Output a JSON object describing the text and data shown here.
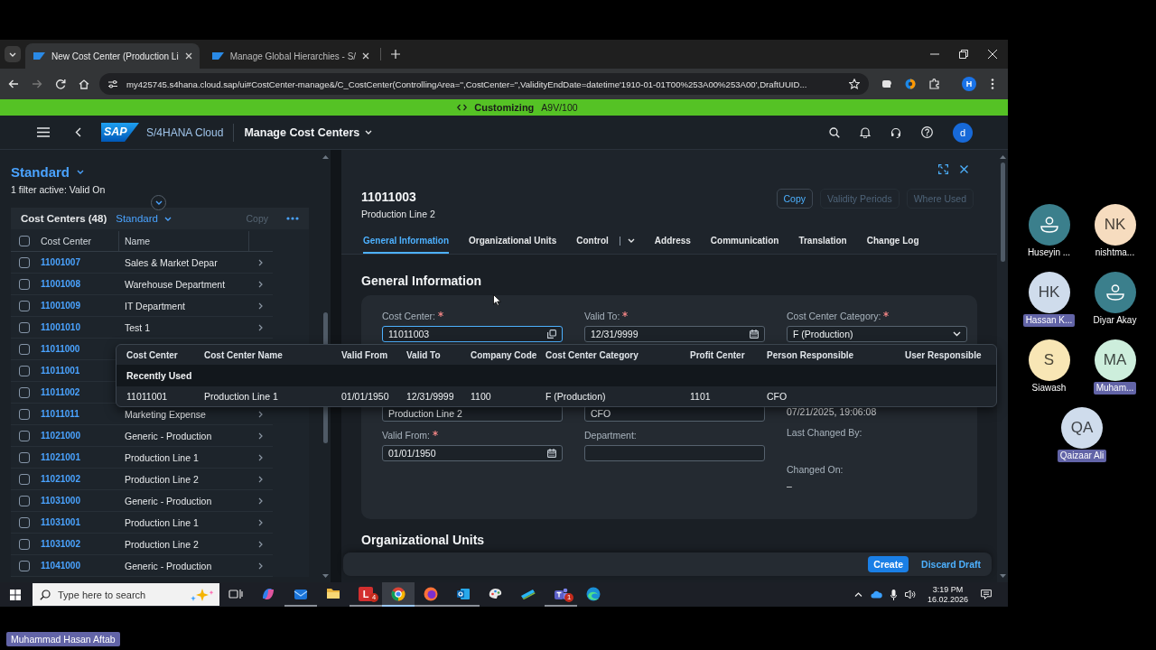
{
  "browser": {
    "tabs": [
      {
        "title": "New Cost Center (Production Li",
        "selected": true
      },
      {
        "title": "Manage Global Hierarchies - S/",
        "selected": false
      }
    ],
    "url": "my425745.s4hana.cloud.sap/ui#CostCenter-manage&/C_CostCenter(ControllingArea='',CostCenter='',ValidityEndDate=datetime'1910-01-01T00%253A00%253A00',DraftUUID...",
    "profile_initial": "H"
  },
  "system_bar": {
    "mode": "Customizing",
    "system": "A9V/100"
  },
  "shell_bar": {
    "logo": "SAP",
    "product": "S/4HANA Cloud",
    "app_title": "Manage Cost Centers",
    "user_initial": "d"
  },
  "list_pane": {
    "variant": "Standard",
    "filter_info": "1 filter active: Valid On",
    "table_title": "Cost Centers (48)",
    "table_variant": "Standard",
    "copy": {
      "label": "Copy",
      "disabled": true
    },
    "select_all_checked": false,
    "columns": [
      "Cost Center",
      "Name"
    ],
    "rows": [
      {
        "id": "11001007",
        "name": "Sales & Market Depar",
        "checked": false
      },
      {
        "id": "11001008",
        "name": "Warehouse Department",
        "checked": false
      },
      {
        "id": "11001009",
        "name": "IT Department",
        "checked": false
      },
      {
        "id": "11001010",
        "name": "Test 1",
        "checked": false
      },
      {
        "id": "11011000",
        "checked": false
      },
      {
        "id": "11011001",
        "checked": false
      },
      {
        "id": "11011002",
        "checked": false
      },
      {
        "id": "11011011",
        "name": "Marketing Expense",
        "checked": false
      },
      {
        "id": "11021000",
        "name": "Generic - Production",
        "checked": false
      },
      {
        "id": "11021001",
        "name": "Production Line 1",
        "checked": false
      },
      {
        "id": "11021002",
        "name": "Production Line 2",
        "checked": false
      },
      {
        "id": "11031000",
        "name": "Generic - Production",
        "checked": false
      },
      {
        "id": "11031001",
        "name": "Production Line 1",
        "checked": false
      },
      {
        "id": "11031002",
        "name": "Production Line 2",
        "checked": false
      },
      {
        "id": "11041000",
        "name": "Generic - Production",
        "checked": false
      }
    ]
  },
  "object_page": {
    "title": "11011003",
    "subtitle": "Production Line 2",
    "actions": [
      {
        "label": "Copy",
        "disabled": false
      },
      {
        "label": "Validity Periods",
        "disabled": true
      },
      {
        "label": "Where Used",
        "disabled": true
      }
    ],
    "tabs": [
      {
        "label": "General Information",
        "selected": true,
        "has_menu": false
      },
      {
        "label": "Organizational Units",
        "selected": false,
        "has_menu": false
      },
      {
        "label": "Control",
        "selected": false,
        "has_menu": true
      },
      {
        "label": "Address",
        "selected": false,
        "has_menu": false
      },
      {
        "label": "Communication",
        "selected": false,
        "has_menu": false
      },
      {
        "label": "Translation",
        "selected": false,
        "has_menu": false
      },
      {
        "label": "Change Log",
        "selected": false,
        "has_menu": false
      }
    ],
    "section_title": "General Information",
    "form_columns": [
      [
        {
          "kind": "copyable",
          "label": "Cost Center:",
          "required": true,
          "value": "11011003",
          "focused": true
        },
        {
          "kind": "input",
          "value": "Production Line 2",
          "focused": false
        },
        {
          "kind": "date",
          "label": "Valid From:",
          "required": true,
          "value": "01/01/1950",
          "focused": false
        }
      ],
      [
        {
          "kind": "date",
          "label": "Valid To:",
          "required": true,
          "value": "12/31/9999",
          "focused": false
        },
        {
          "kind": "input",
          "value": "CFO",
          "focused": false
        },
        {
          "kind": "input",
          "label": "Department:",
          "required": false,
          "focused": false
        }
      ],
      [
        {
          "kind": "select",
          "label": "Cost Center Category:",
          "required": true,
          "value": "F (Production)"
        },
        {
          "kind": "text",
          "value": "07/21/2025, 19:06:08"
        },
        {
          "kind": "text",
          "label": "Last Changed By:"
        },
        {
          "kind": "text",
          "label": "Changed On:",
          "value": "–"
        }
      ]
    ],
    "next_section_title": "Organizational Units",
    "footer_buttons": [
      {
        "label": "Create",
        "kind": "emphasized"
      },
      {
        "label": "Discard Draft",
        "kind": "transparent"
      }
    ]
  },
  "suggestions": {
    "columns": [
      "Cost Center",
      "Cost Center Name",
      "Valid From",
      "Valid To",
      "Company Code",
      "Cost Center Category",
      "Profit Center",
      "Person Responsible",
      "User Responsible"
    ],
    "group": "Recently Used",
    "rows": [
      {
        "cells": [
          "11011001",
          "Production Line 1",
          "01/01/1950",
          "12/31/9999",
          "1100",
          "F (Production)",
          "1101",
          "CFO"
        ]
      }
    ]
  },
  "taskbar": {
    "search_placeholder": "Type here to search",
    "apps": [
      {
        "kind": "task_view",
        "selected": false,
        "running": false
      },
      {
        "kind": "copilot",
        "selected": false,
        "running": false
      },
      {
        "kind": "mail",
        "selected": false,
        "running": true
      },
      {
        "kind": "folder",
        "selected": false,
        "running": false
      },
      {
        "kind": "letter",
        "label": "L",
        "badge": "4",
        "selected": false,
        "running": true
      },
      {
        "kind": "chrome",
        "selected": true,
        "running": true
      },
      {
        "kind": "firefox",
        "selected": false,
        "running": true
      },
      {
        "kind": "outlook",
        "selected": false,
        "running": true
      },
      {
        "kind": "palette",
        "selected": false,
        "running": false
      },
      {
        "kind": "pen",
        "selected": false,
        "running": false
      },
      {
        "kind": "teams",
        "badge": "1",
        "selected": false,
        "running": true
      },
      {
        "kind": "edge",
        "selected": false,
        "running": false
      }
    ],
    "time": "3:19 PM",
    "date": "16.02.2026"
  },
  "meeting": {
    "participants": [
      {
        "name": "Huseyin ...",
        "kind": "person",
        "color": "#3b7f8c",
        "highlighted": false
      },
      {
        "name": "nishtma...",
        "kind": "initials",
        "initials": "NK",
        "color": "#f6dcbf",
        "highlighted": false
      },
      {
        "name": "Hassan K...",
        "kind": "initials",
        "initials": "HK",
        "color": "#cfdcec",
        "highlighted": true
      },
      {
        "name": "Diyar Akay",
        "kind": "person",
        "color": "#3b7f8c",
        "highlighted": false
      },
      {
        "name": "Siawash",
        "kind": "initials",
        "initials": "S",
        "color": "#f8e6b5",
        "highlighted": false
      },
      {
        "name": "Muham...",
        "kind": "initials",
        "initials": "MA",
        "color": "#cdeedc",
        "highlighted": true
      },
      {
        "name": "Qaizaar Ali",
        "kind": "initials",
        "initials": "QA",
        "color": "#cfdcec",
        "highlighted": true
      }
    ],
    "presenter": "Muhammad Hasan Aftab"
  }
}
